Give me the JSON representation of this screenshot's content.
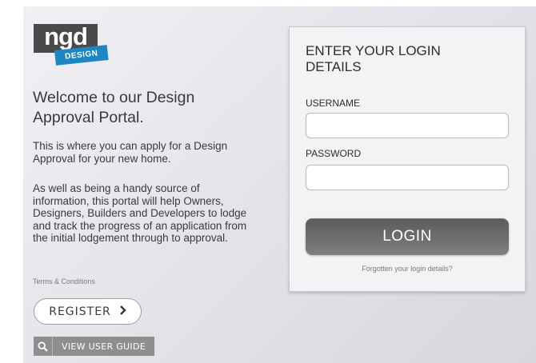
{
  "brand": {
    "logo_text": "ngd",
    "logo_tag": "DESIGN",
    "colors": {
      "logo_dark": "#4a4a4a",
      "logo_blue": "#1f86c4"
    }
  },
  "intro": {
    "heading": "Welcome to our Design Approval Portal.",
    "paragraph_1": "This is where you can apply for a Design Approval for your new home.",
    "paragraph_2": "As well as being a handy source of information, this portal will help Owners, Designers, Builders and Developers to lodge and track the progress of an application from the initial lodgement through to approval."
  },
  "links": {
    "terms": "Terms & Conditions"
  },
  "actions": {
    "register_label": "REGISTER",
    "register_icon": "chevron-right-icon",
    "guide_label": "VIEW USER GUIDE",
    "guide_icon": "search-icon"
  },
  "login": {
    "title": "ENTER YOUR LOGIN DETAILS",
    "username_label": "USERNAME",
    "username_value": "",
    "password_label": "PASSWORD",
    "password_value": "",
    "button_label": "LOGIN",
    "forgot_link": "Forgotten your login details?"
  }
}
